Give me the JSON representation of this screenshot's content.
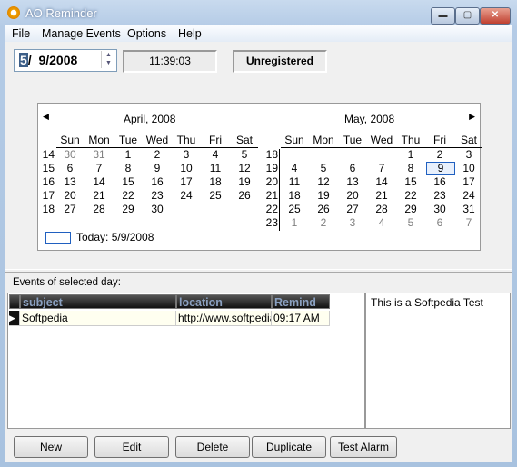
{
  "window": {
    "title": "AO Reminder",
    "controls": [
      "minimize",
      "maximize",
      "close"
    ]
  },
  "menu": [
    "File",
    "Manage Events",
    "Options",
    "Help"
  ],
  "toolbar": {
    "date_month": "5",
    "date_rest": "/  9/2008",
    "time": "11:39:03",
    "status": "Unregistered"
  },
  "calendar": {
    "weekdays": [
      "Sun",
      "Mon",
      "Tue",
      "Wed",
      "Thu",
      "Fri",
      "Sat"
    ],
    "months": [
      {
        "title": "April, 2008",
        "weeks": [
          "14",
          "15",
          "16",
          "17",
          "18"
        ],
        "days": [
          [
            "30",
            "31",
            "1",
            "2",
            "3",
            "4",
            "5"
          ],
          [
            "6",
            "7",
            "8",
            "9",
            "10",
            "11",
            "12"
          ],
          [
            "13",
            "14",
            "15",
            "16",
            "17",
            "18",
            "19"
          ],
          [
            "20",
            "21",
            "22",
            "23",
            "24",
            "25",
            "26"
          ],
          [
            "27",
            "28",
            "29",
            "30",
            "",
            "",
            ""
          ]
        ],
        "gray_first_row": 2,
        "gray_last_row": 0
      },
      {
        "title": "May, 2008",
        "weeks": [
          "18",
          "19",
          "20",
          "21",
          "22",
          "23"
        ],
        "days": [
          [
            "",
            "",
            "",
            "",
            "1",
            "2",
            "3"
          ],
          [
            "4",
            "5",
            "6",
            "7",
            "8",
            "9",
            "10"
          ],
          [
            "11",
            "12",
            "13",
            "14",
            "15",
            "16",
            "17"
          ],
          [
            "18",
            "19",
            "20",
            "21",
            "22",
            "23",
            "24"
          ],
          [
            "25",
            "26",
            "27",
            "28",
            "29",
            "30",
            "31"
          ],
          [
            "1",
            "2",
            "3",
            "4",
            "5",
            "6",
            "7"
          ]
        ],
        "gray_first_row": 0,
        "gray_last_row": 7
      }
    ],
    "selected": "9",
    "today_label": "Today: 5/9/2008",
    "accent": "#2060c0"
  },
  "events": {
    "label": "Events of selected day:",
    "columns": [
      "subject",
      "location",
      "Remind at"
    ],
    "rows": [
      {
        "subject": "Softpedia",
        "location": "http://www.softpedia.com",
        "remind": "09:17 AM"
      }
    ],
    "note": "This is  a Softpedia Test"
  },
  "buttons": [
    "New",
    "Edit",
    "Delete",
    "Duplicate",
    "Test Alarm"
  ]
}
